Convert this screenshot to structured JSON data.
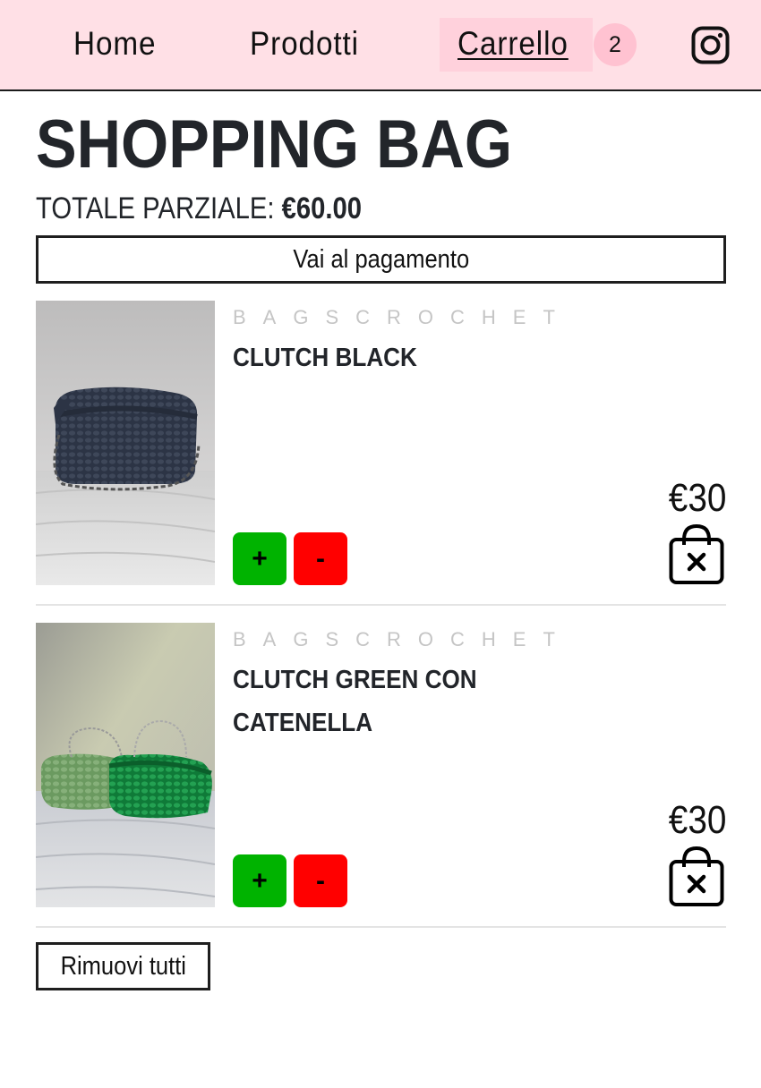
{
  "nav": {
    "home": "Home",
    "products": "Prodotti",
    "cart": "Carrello",
    "cart_count": "2",
    "social_icon": "instagram-icon"
  },
  "page": {
    "title": "SHOPPING BAG",
    "subtotal_label": "TOTALE PARZIALE: ",
    "subtotal_value": "€60.00",
    "checkout_label": "Vai al pagamento",
    "remove_all_label": "Rimuovi tutti"
  },
  "items": [
    {
      "brand": "BAGSCROCHET",
      "name": "CLUTCH BLACK",
      "price": "€30",
      "plus": "+",
      "minus": "-",
      "remove_icon": "bag-remove-icon"
    },
    {
      "brand": "BAGSCROCHET",
      "name": "CLUTCH GREEN CON CATENELLA",
      "price": "€30",
      "plus": "+",
      "minus": "-",
      "remove_icon": "bag-remove-icon"
    }
  ],
  "colors": {
    "navbar_bg": "#ffe0e6",
    "active_tab_bg": "#ffd1dc",
    "badge_bg": "#ffc2d1",
    "increment_green": "#00b300",
    "decrement_red": "#ff0000"
  }
}
